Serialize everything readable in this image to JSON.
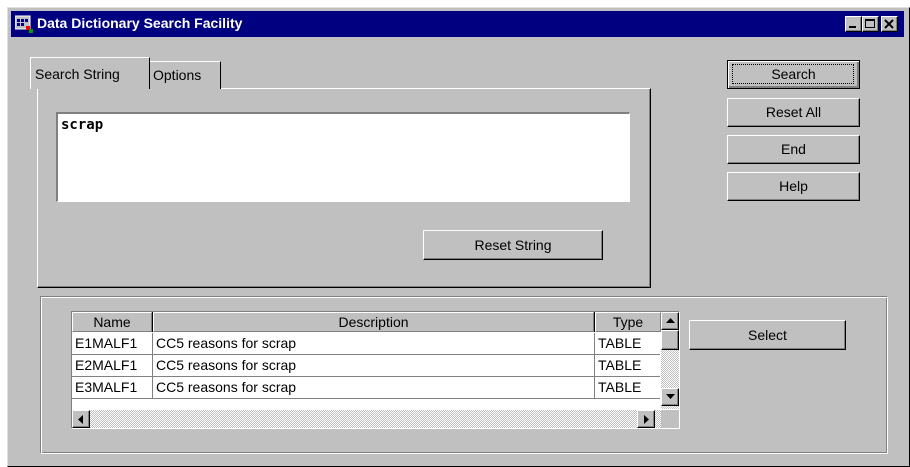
{
  "window": {
    "title": "Data Dictionary Search Facility",
    "icon": "app-grid-icon",
    "controls": [
      "minimize-icon",
      "maximize-icon",
      "close-icon"
    ]
  },
  "tabs": [
    {
      "label": "Search String",
      "active": true
    },
    {
      "label": "Options",
      "active": false
    }
  ],
  "search": {
    "value": "scrap",
    "reset_label": "Reset String"
  },
  "actions": {
    "search_label": "Search",
    "reset_all_label": "Reset All",
    "end_label": "End",
    "help_label": "Help",
    "select_label": "Select"
  },
  "results": {
    "columns": [
      "Name",
      "Description",
      "Type"
    ],
    "rows": [
      {
        "name": "E1MALF1",
        "description": "CC5 reasons for scrap",
        "type": "TABLE"
      },
      {
        "name": "E2MALF1",
        "description": "CC5 reasons for scrap",
        "type": "TABLE"
      },
      {
        "name": "E3MALF1",
        "description": "CC5 reasons for scrap",
        "type": "TABLE"
      }
    ],
    "scroll_icons": [
      "arrow-up-icon",
      "arrow-down-icon",
      "arrow-left-icon",
      "arrow-right-icon"
    ]
  }
}
